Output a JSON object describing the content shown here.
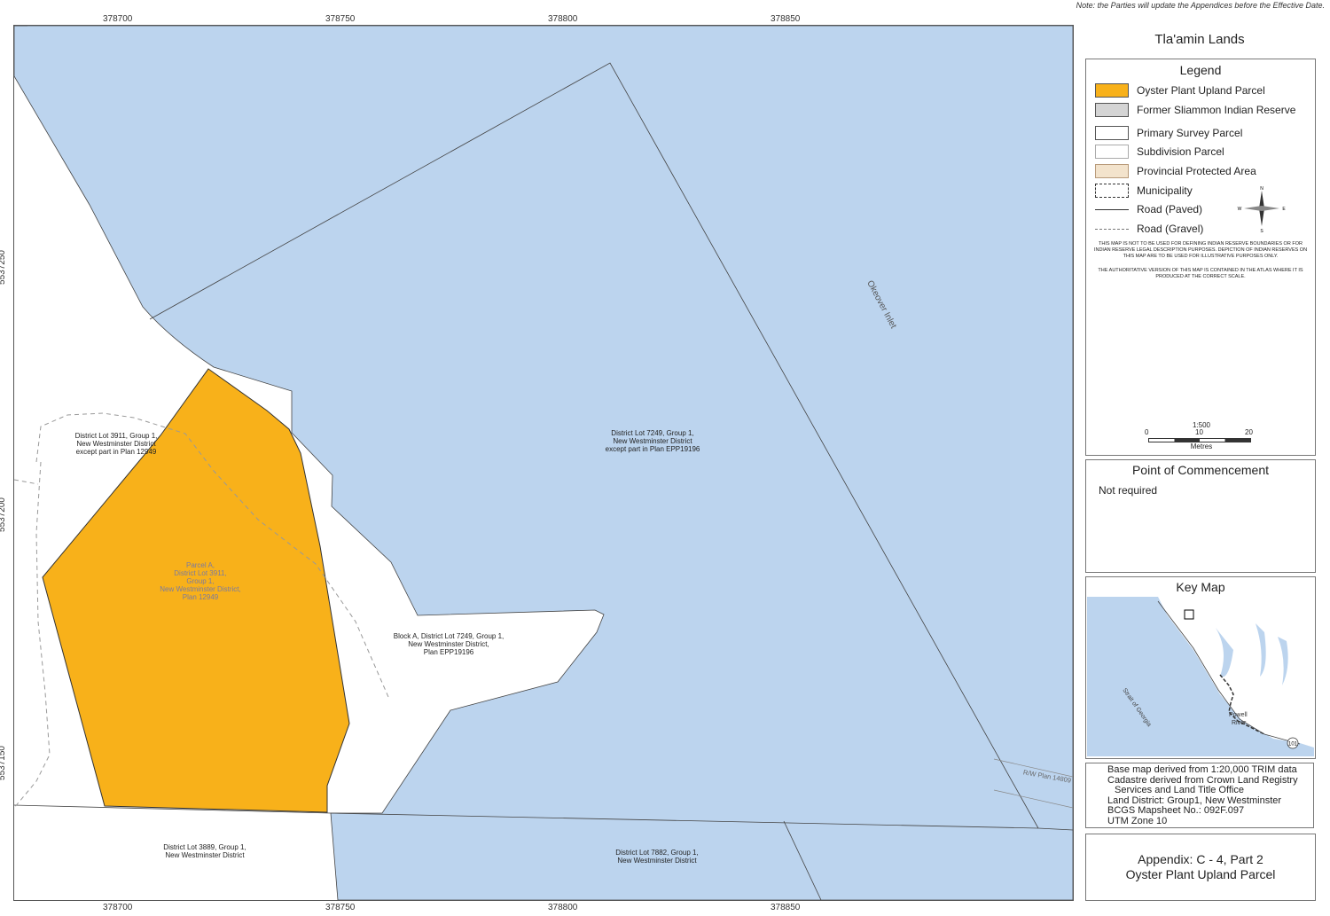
{
  "note": "Note:  the Parties will update the Appendices before the Effective Date.",
  "map": {
    "x_ticks": [
      "378700",
      "378750",
      "378800",
      "378850"
    ],
    "y_ticks": [
      "5537250",
      "5537200",
      "5537150"
    ],
    "labels": {
      "dl3911": [
        "District Lot 3911, Group 1,",
        "New Westminster District",
        "except part in Plan 12949"
      ],
      "parcelA": [
        "Parcel A,",
        "District Lot 3911,",
        "Group 1,",
        "New Westminster District,",
        "Plan 12949"
      ],
      "dl7249": [
        "District Lot 7249, Group 1,",
        "New Westminster District",
        "except part in Plan EPP19196"
      ],
      "blockA": [
        "Block A, District Lot 7249, Group 1,",
        "New Westminster District,",
        "Plan EPP19196"
      ],
      "dl3889": [
        "District Lot 3889, Group 1,",
        "New Westminster District"
      ],
      "dl7882": [
        "District Lot 7882, Group 1,",
        "New Westminster District"
      ],
      "okeover": "Okeover Inlet",
      "rw": "R/W Plan 14809"
    },
    "colors": {
      "water": "#bcd4ee",
      "parcel": "#f8b11a",
      "land": "#ffffff"
    }
  },
  "title": "Tla'amin Lands",
  "legend": {
    "heading": "Legend",
    "items": [
      {
        "label": "Oyster Plant Upland Parcel",
        "swatch": "#f8b11a"
      },
      {
        "label": "Former Sliammon Indian Reserve",
        "swatch": "#d4d4d4"
      },
      {
        "label": "Primary Survey Parcel",
        "swatch": "#ffffff"
      },
      {
        "label": "Subdivision Parcel",
        "swatch": "#ffffff"
      },
      {
        "label": "Provincial Protected Area",
        "swatch": "#f3e3cc"
      },
      {
        "label": "Municipality",
        "swatch": "dashed"
      },
      {
        "label": "Road (Paved)",
        "swatch": "line"
      },
      {
        "label": "Road (Gravel)",
        "swatch": "dashline"
      }
    ],
    "compass": {
      "n": "N",
      "s": "S",
      "e": "E",
      "w": "W"
    },
    "disclaimer1": "This map is not to be used for defining Indian reserve boundaries or for Indian reserve legal description purposes.  Depiction of Indian reserves on this map are to be used for illustrative purposes only.",
    "disclaimer2": "THE AUTHORITATIVE VERSION OF THIS MAP IS CONTAINED IN THE ATLAS WHERE IT IS PRODUCED AT THE CORRECT SCALE.",
    "scale": {
      "ratio": "1:500",
      "ticks": [
        "0",
        "10",
        "20"
      ],
      "unit": "Metres"
    }
  },
  "poc": {
    "heading": "Point of Commencement",
    "text": "Not required"
  },
  "keymap": {
    "heading": "Key Map",
    "strait": "Strait of Georgia",
    "town1": "Powell",
    "town2": "River",
    "highway": "101"
  },
  "source": [
    "Base map derived from 1:20,000 TRIM data",
    "Cadastre derived from Crown Land Registry",
    "Services and Land Title Office",
    "Land District: Group1, New Westminster",
    "BCGS Mapsheet No.: 092F.097",
    "UTM Zone 10"
  ],
  "appendix": {
    "line1": "Appendix:  C - 4, Part 2",
    "line2": "Oyster Plant Upland Parcel"
  }
}
